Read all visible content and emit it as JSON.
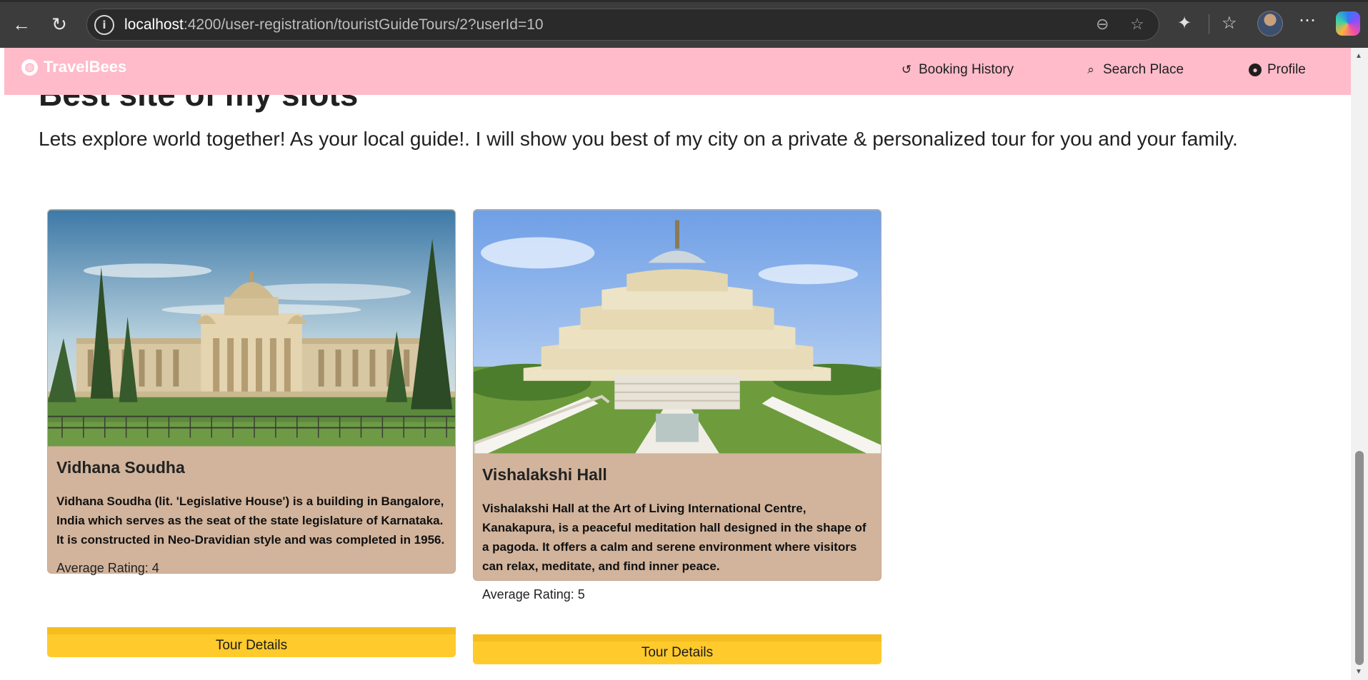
{
  "browser": {
    "url_host": "localhost",
    "url_path": ":4200/user-registration/touristGuideTours/2?userId=10"
  },
  "navbar": {
    "brand": "TravelBees",
    "links": [
      {
        "label": "Booking History",
        "icon": "history-icon"
      },
      {
        "label": "Search Place",
        "icon": "search-icon"
      },
      {
        "label": "Profile",
        "icon": "profile-icon"
      }
    ]
  },
  "page": {
    "heading": "Best site of my slots",
    "intro": "Lets explore world together! As your local guide!. I will show you best of my city on a private & personalized tour for you and your family."
  },
  "tours": [
    {
      "title": "Vidhana Soudha",
      "description": "Vidhana Soudha (lit. 'Legislative House') is a building in Bangalore, India which serves as the seat of the state legislature of Karnataka. It is constructed in Neo-Dravidian style and was completed in 1956.",
      "rating": "Average Rating: 4",
      "button": "Tour Details"
    },
    {
      "title": "Vishalakshi Hall",
      "description": "Vishalakshi Hall at the Art of Living International Centre, Kanakapura, is a peaceful meditation hall designed in the shape of a pagoda. It offers a calm and serene environment where visitors can relax, meditate, and find inner peace.",
      "rating": "Average Rating: 5",
      "button": "Tour Details"
    }
  ],
  "colors": {
    "navbar": "#ffbbca",
    "card": "#d2b49c",
    "button": "#ffca2c"
  }
}
